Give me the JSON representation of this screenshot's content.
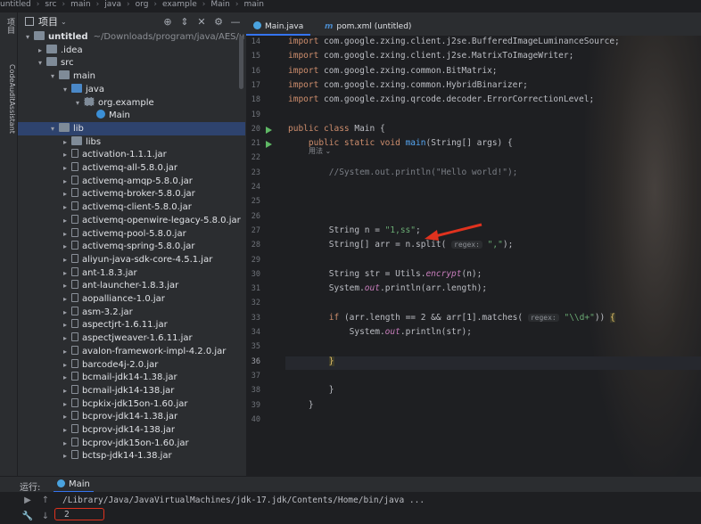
{
  "breadcrumb": [
    "untitled",
    "src",
    "main",
    "java",
    "org",
    "example",
    "Main",
    "main"
  ],
  "left_strip": {
    "project_tab": "项目",
    "plugin_tab": "CodeAuditAssistant"
  },
  "project": {
    "header": "项目",
    "root_name": "untitled",
    "root_path": "~/Downloads/program/java/AES/untitled",
    "items": [
      {
        "label": "untitled",
        "extra": "~/Downloads/program/java/AES/untitled",
        "depth": 0,
        "arrow": "▾",
        "icon": "folder"
      },
      {
        "label": ".idea",
        "depth": 1,
        "arrow": "▸",
        "icon": "folder"
      },
      {
        "label": "src",
        "depth": 1,
        "arrow": "▾",
        "icon": "folder"
      },
      {
        "label": "main",
        "depth": 2,
        "arrow": "▾",
        "icon": "folder"
      },
      {
        "label": "java",
        "depth": 3,
        "arrow": "▾",
        "icon": "blue"
      },
      {
        "label": "org.example",
        "depth": 4,
        "arrow": "▾",
        "icon": "pkg"
      },
      {
        "label": "Main",
        "depth": 5,
        "arrow": "",
        "icon": "cls"
      },
      {
        "label": "lib",
        "depth": 2,
        "arrow": "▾",
        "icon": "folder",
        "selected": true
      },
      {
        "label": "libs",
        "depth": 3,
        "arrow": "▸",
        "icon": "folder"
      },
      {
        "label": "activation-1.1.1.jar",
        "depth": 3,
        "arrow": "▸",
        "icon": "jar"
      },
      {
        "label": "activemq-all-5.8.0.jar",
        "depth": 3,
        "arrow": "▸",
        "icon": "jar"
      },
      {
        "label": "activemq-amqp-5.8.0.jar",
        "depth": 3,
        "arrow": "▸",
        "icon": "jar"
      },
      {
        "label": "activemq-broker-5.8.0.jar",
        "depth": 3,
        "arrow": "▸",
        "icon": "jar"
      },
      {
        "label": "activemq-client-5.8.0.jar",
        "depth": 3,
        "arrow": "▸",
        "icon": "jar"
      },
      {
        "label": "activemq-openwire-legacy-5.8.0.jar",
        "depth": 3,
        "arrow": "▸",
        "icon": "jar"
      },
      {
        "label": "activemq-pool-5.8.0.jar",
        "depth": 3,
        "arrow": "▸",
        "icon": "jar"
      },
      {
        "label": "activemq-spring-5.8.0.jar",
        "depth": 3,
        "arrow": "▸",
        "icon": "jar"
      },
      {
        "label": "aliyun-java-sdk-core-4.5.1.jar",
        "depth": 3,
        "arrow": "▸",
        "icon": "jar"
      },
      {
        "label": "ant-1.8.3.jar",
        "depth": 3,
        "arrow": "▸",
        "icon": "jar"
      },
      {
        "label": "ant-launcher-1.8.3.jar",
        "depth": 3,
        "arrow": "▸",
        "icon": "jar"
      },
      {
        "label": "aopalliance-1.0.jar",
        "depth": 3,
        "arrow": "▸",
        "icon": "jar"
      },
      {
        "label": "asm-3.2.jar",
        "depth": 3,
        "arrow": "▸",
        "icon": "jar"
      },
      {
        "label": "aspectjrt-1.6.11.jar",
        "depth": 3,
        "arrow": "▸",
        "icon": "jar"
      },
      {
        "label": "aspectjweaver-1.6.11.jar",
        "depth": 3,
        "arrow": "▸",
        "icon": "jar"
      },
      {
        "label": "avalon-framework-impl-4.2.0.jar",
        "depth": 3,
        "arrow": "▸",
        "icon": "jar"
      },
      {
        "label": "barcode4j-2.0.jar",
        "depth": 3,
        "arrow": "▸",
        "icon": "jar"
      },
      {
        "label": "bcmail-jdk14-1.38.jar",
        "depth": 3,
        "arrow": "▸",
        "icon": "jar"
      },
      {
        "label": "bcmail-jdk14-138.jar",
        "depth": 3,
        "arrow": "▸",
        "icon": "jar"
      },
      {
        "label": "bcpkix-jdk15on-1.60.jar",
        "depth": 3,
        "arrow": "▸",
        "icon": "jar"
      },
      {
        "label": "bcprov-jdk14-1.38.jar",
        "depth": 3,
        "arrow": "▸",
        "icon": "jar"
      },
      {
        "label": "bcprov-jdk14-138.jar",
        "depth": 3,
        "arrow": "▸",
        "icon": "jar"
      },
      {
        "label": "bcprov-jdk15on-1.60.jar",
        "depth": 3,
        "arrow": "▸",
        "icon": "jar"
      },
      {
        "label": "bctsp-jdk14-1.38.jar",
        "depth": 3,
        "arrow": "▸",
        "icon": "jar"
      }
    ]
  },
  "tabs": [
    {
      "label": "Main.java",
      "active": true,
      "icon": "class-icon"
    },
    {
      "label": "pom.xml (untitled)",
      "active": false,
      "icon": "maven-icon",
      "icon_text": "m"
    }
  ],
  "editor": {
    "usage_hint": "用法 ⌄",
    "lines": [
      {
        "n": "14",
        "html": "<span class='kw'>import</span> com.google.zxing.client.j2se.BufferedImageLuminanceSource;"
      },
      {
        "n": "15",
        "html": "<span class='kw'>import</span> com.google.zxing.client.j2se.MatrixToImageWriter;"
      },
      {
        "n": "16",
        "html": "<span class='kw'>import</span> com.google.zxing.common.BitMatrix;"
      },
      {
        "n": "17",
        "html": "<span class='kw'>import</span> com.google.zxing.common.HybridBinarizer;"
      },
      {
        "n": "18",
        "html": "<span class='kw'>import</span> com.google.zxing.qrcode.decoder.ErrorCorrectionLevel;"
      },
      {
        "n": "19",
        "html": ""
      },
      {
        "n": "20",
        "html": "<span class='kw'>public class</span> Main {",
        "run": true
      },
      {
        "n": "21",
        "html": "    <span class='kw'>public static void</span> <span class='fn'>main</span>(String[] args) {",
        "run": true
      },
      {
        "n": "22",
        "html": ""
      },
      {
        "n": "23",
        "html": "        <span class='cm'>//System.out.println(\"Hello world!\");</span>"
      },
      {
        "n": "24",
        "html": ""
      },
      {
        "n": "25",
        "html": ""
      },
      {
        "n": "26",
        "html": ""
      },
      {
        "n": "27",
        "html": "        String n = <span class='str'>\"1,ss\"</span>;"
      },
      {
        "n": "28",
        "html": "        String[] arr = n.split( <span class='hint'>regex:</span> <span class='str'>\",\"</span>);"
      },
      {
        "n": "29",
        "html": ""
      },
      {
        "n": "30",
        "html": "        String str = Utils.<span class='it'>encrypt</span>(n);"
      },
      {
        "n": "31",
        "html": "        System.<span class='it'>out</span>.println(arr.length);"
      },
      {
        "n": "32",
        "html": ""
      },
      {
        "n": "33",
        "html": "        <span class='kw'>if</span> (arr.length == 2 &amp;&amp; arr[1].matches( <span class='hint'>regex:</span> <span class='str'>\"\\\\d+\"</span>)) <span class='brace'>{</span>"
      },
      {
        "n": "34",
        "html": "            System.<span class='it'>out</span>.println(str);"
      },
      {
        "n": "35",
        "html": ""
      },
      {
        "n": "36",
        "html": "        <span class='brace'>}</span>",
        "current": true
      },
      {
        "n": "37",
        "html": ""
      },
      {
        "n": "38",
        "html": "        }"
      },
      {
        "n": "39",
        "html": "    }"
      },
      {
        "n": "40",
        "html": ""
      }
    ]
  },
  "run_panel": {
    "label": "运行:",
    "tab": "Main",
    "command": "/Library/Java/JavaVirtualMachines/jdk-17.jdk/Contents/Home/bin/java ...",
    "output": "2"
  },
  "colors": {
    "annotation": "#e0321e",
    "accent": "#3574f0"
  }
}
